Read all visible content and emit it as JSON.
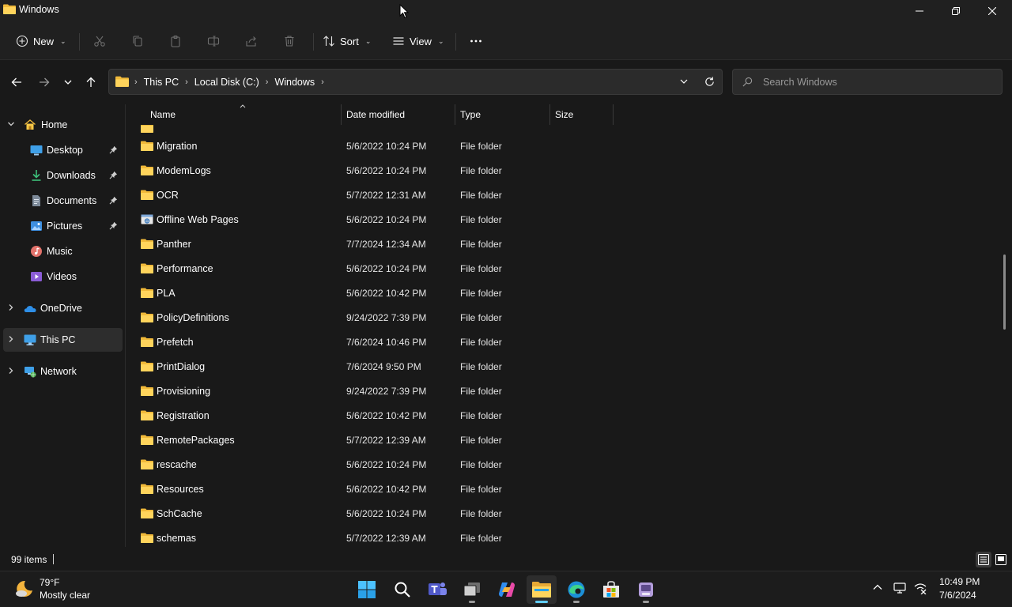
{
  "window": {
    "title": "Windows",
    "controls": [
      "minimize-icon",
      "restore-icon",
      "close-icon"
    ]
  },
  "toolbar": {
    "new_label": "New",
    "sort_label": "Sort",
    "view_label": "View",
    "disabled_actions": [
      "cut-icon",
      "copy-icon",
      "paste-icon",
      "rename-icon",
      "share-icon",
      "delete-icon"
    ],
    "more_icon": "more-icon"
  },
  "address": {
    "breadcrumbs": [
      "This PC",
      "Local Disk (C:)",
      "Windows"
    ]
  },
  "search": {
    "placeholder": "Search Windows"
  },
  "sidebar": {
    "items": [
      {
        "label": "Home",
        "icon": "home-icon",
        "expanded": true
      },
      {
        "label": "Desktop",
        "icon": "desktop-icon",
        "pinned": true
      },
      {
        "label": "Downloads",
        "icon": "download-icon",
        "pinned": true
      },
      {
        "label": "Documents",
        "icon": "document-icon",
        "pinned": true
      },
      {
        "label": "Pictures",
        "icon": "pictures-icon",
        "pinned": true
      },
      {
        "label": "Music",
        "icon": "music-icon"
      },
      {
        "label": "Videos",
        "icon": "videos-icon"
      },
      {
        "label": "OneDrive",
        "icon": "onedrive-icon"
      },
      {
        "label": "This PC",
        "icon": "this-pc-icon",
        "selected": true
      },
      {
        "label": "Network",
        "icon": "network-icon"
      }
    ]
  },
  "columns": {
    "name": "Name",
    "date": "Date modified",
    "type": "Type",
    "size": "Size"
  },
  "files": [
    {
      "name": "Migration",
      "date": "5/6/2022 10:24 PM",
      "type": "File folder"
    },
    {
      "name": "ModemLogs",
      "date": "5/6/2022 10:24 PM",
      "type": "File folder"
    },
    {
      "name": "OCR",
      "date": "5/7/2022 12:31 AM",
      "type": "File folder"
    },
    {
      "name": "Offline Web Pages",
      "date": "5/6/2022 10:24 PM",
      "type": "File folder",
      "icon": "special-folder-icon"
    },
    {
      "name": "Panther",
      "date": "7/7/2024 12:34 AM",
      "type": "File folder"
    },
    {
      "name": "Performance",
      "date": "5/6/2022 10:24 PM",
      "type": "File folder"
    },
    {
      "name": "PLA",
      "date": "5/6/2022 10:42 PM",
      "type": "File folder"
    },
    {
      "name": "PolicyDefinitions",
      "date": "9/24/2022 7:39 PM",
      "type": "File folder"
    },
    {
      "name": "Prefetch",
      "date": "7/6/2024 10:46 PM",
      "type": "File folder"
    },
    {
      "name": "PrintDialog",
      "date": "7/6/2024 9:50 PM",
      "type": "File folder"
    },
    {
      "name": "Provisioning",
      "date": "9/24/2022 7:39 PM",
      "type": "File folder"
    },
    {
      "name": "Registration",
      "date": "5/6/2022 10:42 PM",
      "type": "File folder"
    },
    {
      "name": "RemotePackages",
      "date": "5/7/2022 12:39 AM",
      "type": "File folder"
    },
    {
      "name": "rescache",
      "date": "5/6/2022 10:24 PM",
      "type": "File folder"
    },
    {
      "name": "Resources",
      "date": "5/6/2022 10:42 PM",
      "type": "File folder"
    },
    {
      "name": "SchCache",
      "date": "5/6/2022 10:24 PM",
      "type": "File folder"
    },
    {
      "name": "schemas",
      "date": "5/7/2022 12:39 AM",
      "type": "File folder"
    }
  ],
  "status": {
    "item_count": "99 items"
  },
  "taskbar": {
    "weather_temp": "79°F",
    "weather_desc": "Mostly clear",
    "apps": [
      "windows-start-icon",
      "search-icon",
      "teams-icon",
      "task-view-icon",
      "copilot-icon",
      "file-explorer-icon",
      "edge-icon",
      "store-icon",
      "app-icon"
    ],
    "time": "10:49 PM",
    "date": "7/6/2024"
  },
  "colors": {
    "accent": "#60cdff",
    "folder": "#f4c542",
    "background": "#191919",
    "chrome": "#202020"
  }
}
